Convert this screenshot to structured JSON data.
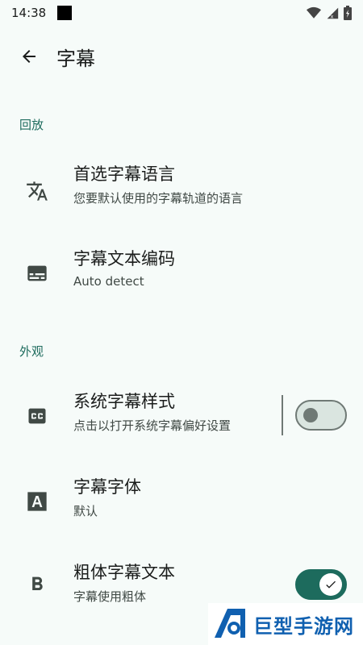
{
  "status_bar": {
    "time": "14:38",
    "icons": [
      "wifi-icon",
      "signal-icon",
      "battery-icon"
    ]
  },
  "top_bar": {
    "back_icon": "arrow-back-icon",
    "title": "字幕"
  },
  "sections": {
    "playback": {
      "header": "回放",
      "preferred_language": {
        "icon": "translate-icon",
        "title": "首选字幕语言",
        "subtitle": "您要默认使用的字幕轨道的语言"
      },
      "text_encoding": {
        "icon": "subtitles-icon",
        "title": "字幕文本编码",
        "subtitle": "Auto detect"
      }
    },
    "appearance": {
      "header": "外观",
      "system_style": {
        "icon": "closed-caption-icon",
        "title": "系统字幕样式",
        "subtitle": "点击以打开系统字幕偏好设置",
        "switch_on": false
      },
      "font": {
        "icon": "font-a-icon",
        "title": "字幕字体",
        "subtitle": "默认"
      },
      "bold": {
        "icon": "bold-icon",
        "title": "粗体字幕文本",
        "subtitle": "字幕使用粗体",
        "switch_on": true
      }
    }
  },
  "watermark": {
    "text": "巨型手游网"
  },
  "colors": {
    "accent": "#1d6b5d",
    "background": "#f6fbf9",
    "icon": "#404945"
  }
}
